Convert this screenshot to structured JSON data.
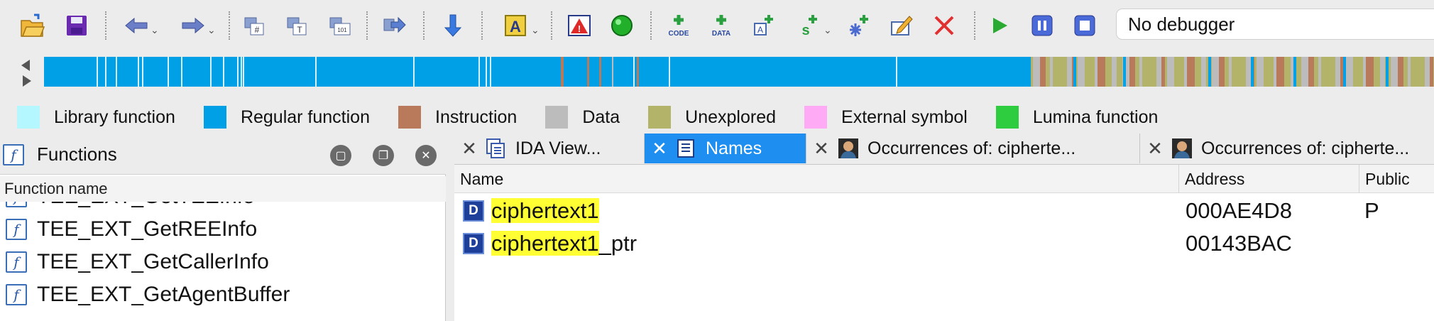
{
  "toolbar": {
    "icons": [
      "open-icon",
      "save-icon",
      "back-icon",
      "forward-icon",
      "hex-view-icon",
      "text-view-icon",
      "number-view-icon",
      "export-icon",
      "jump-down-icon",
      "string-icon",
      "error-icon",
      "green-dot-icon",
      "code-icon",
      "data-icon",
      "add-struct-icon",
      "add-string-icon",
      "add-enum-icon",
      "edit-icon",
      "delete-icon",
      "run-icon",
      "pause-icon",
      "stop-icon"
    ],
    "debugger_select": "No debugger"
  },
  "legend": [
    {
      "label": "Library function",
      "color": "#b4f7ff"
    },
    {
      "label": "Regular function",
      "color": "#00a0e6"
    },
    {
      "label": "Instruction",
      "color": "#b87a5a"
    },
    {
      "label": "Data",
      "color": "#bcbcbc"
    },
    {
      "label": "Unexplored",
      "color": "#b3b36a"
    },
    {
      "label": "External symbol",
      "color": "#ffaaf5"
    },
    {
      "label": "Lumina function",
      "color": "#2ecc3f"
    }
  ],
  "functions_panel": {
    "title": "Functions",
    "column_header": "Function name",
    "items": [
      "TEE_EXT_GetTEEInfo",
      "TEE_EXT_GetREEInfo",
      "TEE_EXT_GetCallerInfo",
      "TEE_EXT_GetAgentBuffer"
    ]
  },
  "tabs": [
    {
      "label": "IDA View...",
      "active": false
    },
    {
      "label": "Names",
      "active": true
    },
    {
      "label": "Occurrences of: cipherte...",
      "active": false
    },
    {
      "label": "Occurrences of: cipherte...",
      "active": false
    }
  ],
  "names_view": {
    "columns": {
      "name": "Name",
      "address": "Address",
      "public": "Public"
    },
    "search_highlight": "ciphertext1",
    "rows": [
      {
        "match": "ciphertext1",
        "rest": "",
        "address": "000AE4D8",
        "public": "P"
      },
      {
        "match": "ciphertext1",
        "rest": "_ptr",
        "address": "00143BAC",
        "public": ""
      }
    ]
  }
}
